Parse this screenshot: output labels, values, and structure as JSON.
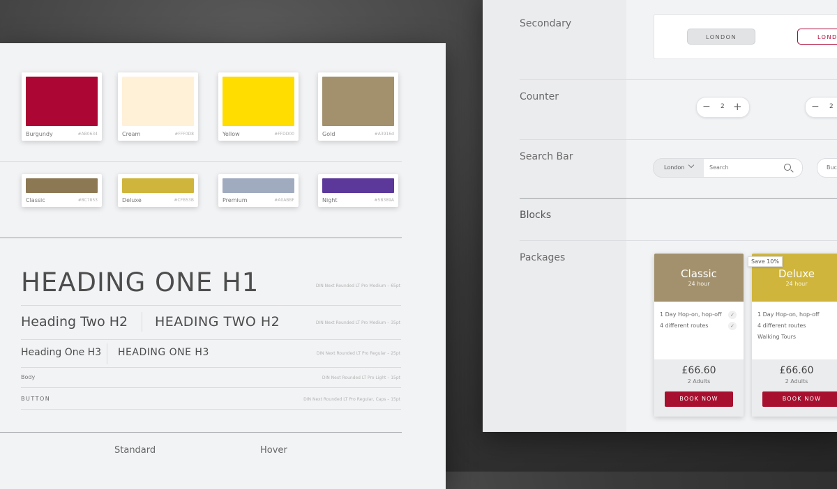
{
  "palette": {
    "primary": [
      {
        "name": "Burgundy",
        "hex": "#AB0634",
        "color": "#ab0634"
      },
      {
        "name": "Cream",
        "hex": "#FFF0D8",
        "color": "#fff0d8"
      },
      {
        "name": "Yellow",
        "hex": "#FFDD00",
        "color": "#ffdd00"
      },
      {
        "name": "Gold",
        "hex": "#A3916d",
        "color": "#a3916d"
      }
    ],
    "secondary": [
      {
        "name": "Classic",
        "hex": "#8C7853",
        "color": "#8c7853"
      },
      {
        "name": "Deluxe",
        "hex": "#CFB53B",
        "color": "#cfb53b"
      },
      {
        "name": "Premium",
        "hex": "#A0ABBF",
        "color": "#a0abbf"
      },
      {
        "name": "Night",
        "hex": "#5B389A",
        "color": "#5b389a"
      }
    ]
  },
  "typography": {
    "h1": {
      "sample": "HEADING ONE H1",
      "meta": "DIN Next Rounded LT Pro Medium – 65pt"
    },
    "h2": {
      "sample": "Heading Two H2",
      "sample_caps": "HEADING TWO H2",
      "meta": "DIN Next Rounded LT Pro Medium – 35pt"
    },
    "h3": {
      "sample": "Heading One H3",
      "sample_caps": "HEADING ONE H3",
      "meta": "DIN Next Rounded LT Pro Regular – 25pt"
    },
    "body": {
      "sample": "Body",
      "meta": "DIN Next Rounded LT Pro Light – 15pt"
    },
    "button": {
      "sample": "BUTTON",
      "meta": "DIN Next Rounded LT Pro Regular, Caps – 15pt"
    }
  },
  "states": {
    "standard": "Standard",
    "hover": "Hover"
  },
  "components": {
    "secondary": {
      "label": "Secondary",
      "button": "LONDON",
      "button_hover": "LONDO"
    },
    "counter": {
      "label": "Counter",
      "value": "2",
      "minus": "−",
      "plus": "+"
    },
    "search": {
      "label": "Search Bar",
      "city": "London",
      "placeholder": "Search",
      "partial": "Buck"
    },
    "blocks": {
      "label": "Blocks"
    },
    "packages": {
      "label": "Packages"
    }
  },
  "packages": [
    {
      "title": "Classic",
      "duration": "24 hour",
      "color": "#a3916d",
      "features": [
        "1 Day Hop-on, hop-off",
        "4 different routes"
      ],
      "price": "£66.60",
      "adults": "2 Adults",
      "cta": "BOOK NOW"
    },
    {
      "title": "Deluxe",
      "duration": "24 hour",
      "color": "#cfb53b",
      "badge": "Save 10%",
      "features": [
        "1 Day Hop-on, hop-off",
        "4 different routes",
        "Walking Tours"
      ],
      "price": "£66.60",
      "adults": "2 Adults",
      "cta": "BOOK NOW"
    }
  ],
  "icons": {
    "tick": "✓",
    "chevron": "⌄"
  }
}
